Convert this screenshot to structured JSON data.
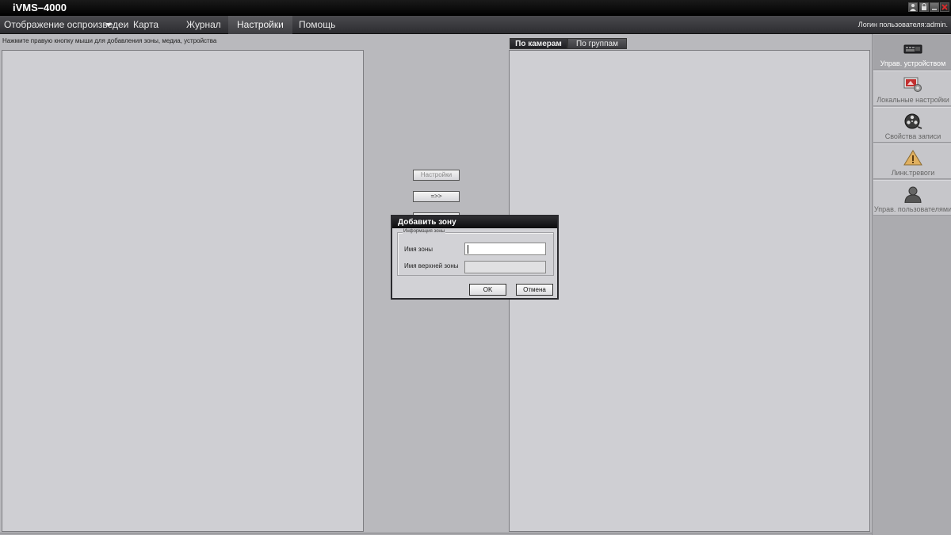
{
  "app": {
    "title": "iVMS–4000"
  },
  "window_controls": [
    {
      "icon": "user-icon"
    },
    {
      "icon": "lock-icon"
    },
    {
      "icon": "minimize-icon"
    },
    {
      "icon": "close-icon"
    }
  ],
  "menu": {
    "items": [
      {
        "label": "Отображение оспроизведеи",
        "active": false,
        "has_dropdown": true
      },
      {
        "label": "Карта",
        "active": false
      },
      {
        "label": "Журнал",
        "active": false
      },
      {
        "label": "Настройки",
        "active": true
      },
      {
        "label": "Помощь",
        "active": false
      }
    ],
    "user_label": "Логин пользователя:admin."
  },
  "hint": "Нажмите правую кнопку мыши для добавления зоны, медиа, устройства",
  "middle_buttons": {
    "settings": "Настройки",
    "transfer": "=>>"
  },
  "tabs": [
    {
      "label": "По камерам",
      "active": true
    },
    {
      "label": "По группам",
      "active": false
    }
  ],
  "sidebar": {
    "items": [
      {
        "label": "Управ. устройством",
        "icon": "device-icon",
        "active": true
      },
      {
        "label": "Локальные настройки",
        "icon": "local-settings-icon",
        "active": false
      },
      {
        "label": "Свойства записи",
        "icon": "film-reel-icon",
        "active": false
      },
      {
        "label": "Линк.тревоги",
        "icon": "warning-icon",
        "active": false
      },
      {
        "label": "Управ. пользователями",
        "icon": "user-icon",
        "active": false
      }
    ]
  },
  "dialog": {
    "title": "Добавить зону",
    "group": "Информация зоны",
    "zone_name_label": "Имя зоны",
    "zone_name_value": "",
    "parent_zone_label": "Имя верхней зоны",
    "parent_zone_value": "",
    "ok": "OK",
    "cancel": "Отмена"
  },
  "colors": {
    "background": "#b9b9bd",
    "panel": "#cfcfd3",
    "title_bar": "#000000",
    "menu_bar": "#3a3a3e",
    "close_button": "#cc2222"
  }
}
